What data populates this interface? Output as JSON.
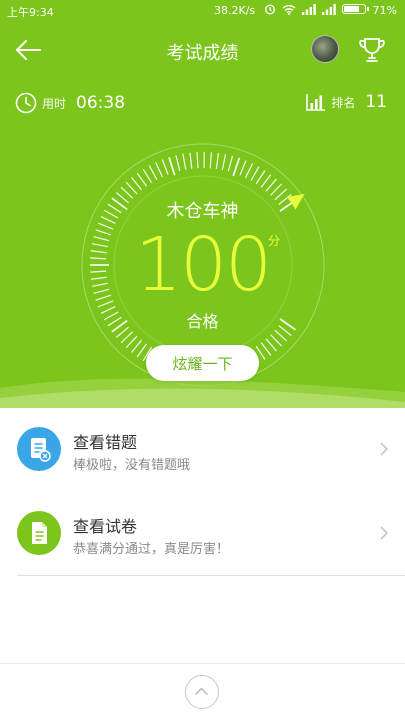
{
  "status_bar": {
    "time": "上午9:34",
    "network_speed": "38.2K/s",
    "battery_percent": "71%"
  },
  "nav": {
    "title": "考试成绩"
  },
  "stats": {
    "duration_label": "用时",
    "duration_value": "06:38",
    "rank_label": "排名",
    "rank_value": "11"
  },
  "result": {
    "title": "木仓车神",
    "score": "100",
    "unit": "分",
    "grade": "合格",
    "score_fraction": 1.0
  },
  "share_button": "炫耀一下",
  "list": [
    {
      "title": "查看错题",
      "subtitle": "棒极啦，没有错题哦",
      "icon": "wrong-questions-icon",
      "color": "#3aa6e8"
    },
    {
      "title": "查看试卷",
      "subtitle": "恭喜满分通过，真是厉害！",
      "icon": "exam-paper-icon",
      "color": "#7cc51c"
    }
  ],
  "colors": {
    "hero": "#7cc51c",
    "score": "#e6ff3a",
    "accent_text": "#6cb51a"
  }
}
